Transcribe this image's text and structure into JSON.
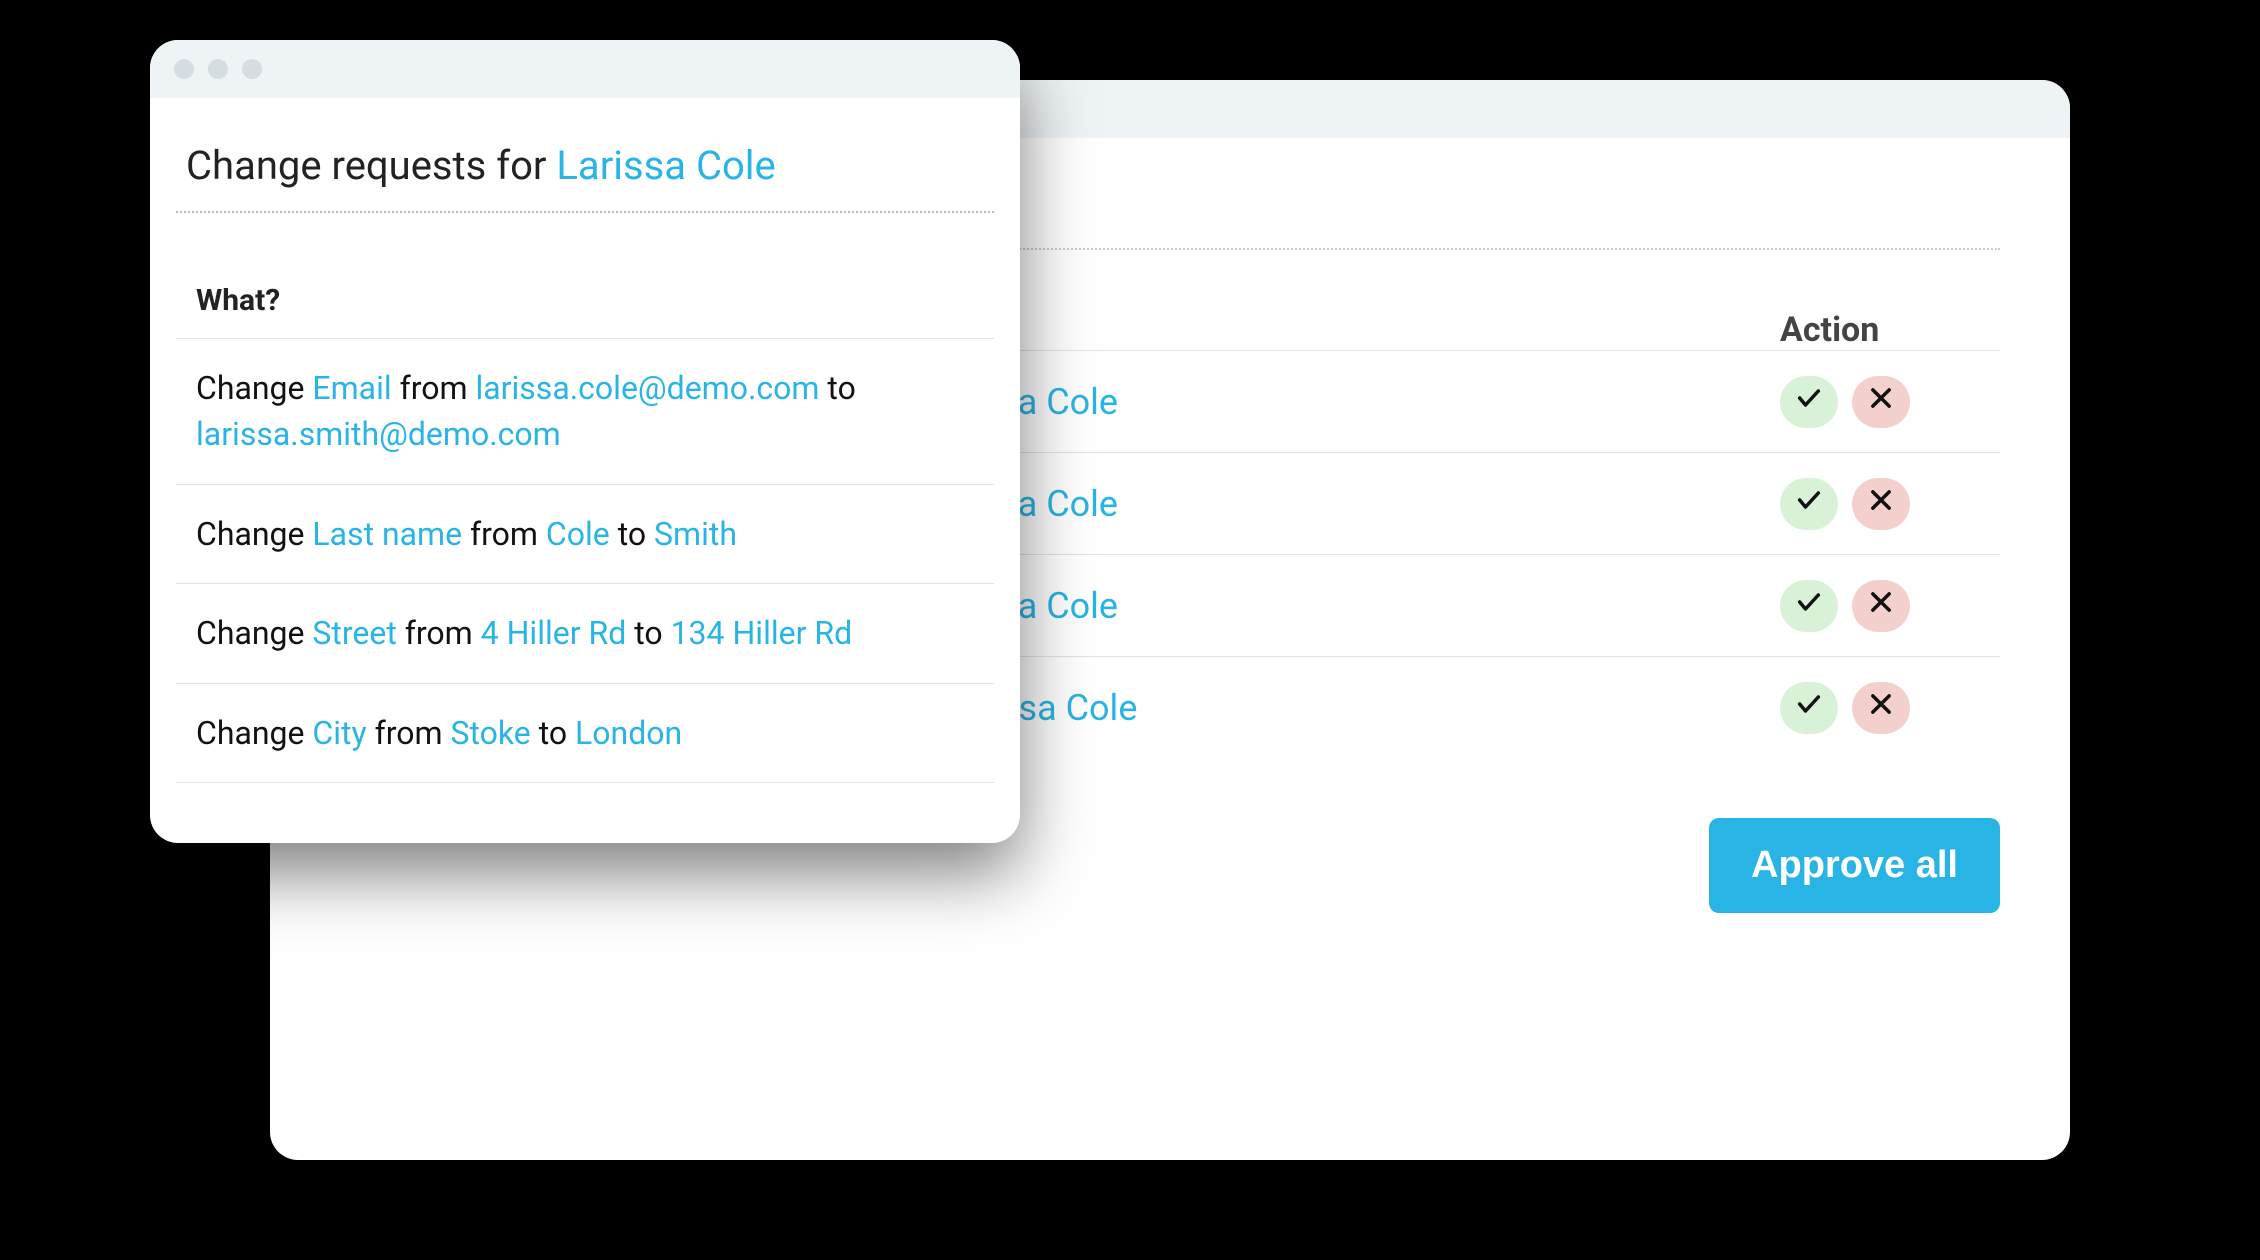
{
  "colors": {
    "accent": "#29b4e6",
    "approve_bg": "#d8f2d8",
    "reject_bg": "#f4d0cd"
  },
  "back": {
    "action_header": "Action",
    "approve_all_label": "Approve all",
    "rows": [
      {
        "who_visible": "arissa Cole"
      },
      {
        "who_visible": "arissa Cole"
      },
      {
        "who_visible": "arissa Cole"
      },
      {
        "who_visible": "Larissa Cole"
      }
    ]
  },
  "front": {
    "title_prefix": "Change requests for ",
    "title_person": "Larissa Cole",
    "what_label": "What?",
    "changes": [
      {
        "verb": "Change",
        "field": "Email",
        "from_word": "from",
        "from_value": "larissa.cole@demo.com",
        "to_word": "to",
        "to_value": "larissa.smith@demo.com"
      },
      {
        "verb": "Change",
        "field": "Last name",
        "from_word": "from",
        "from_value": "Cole",
        "to_word": "to",
        "to_value": "Smith"
      },
      {
        "verb": "Change",
        "field": "Street",
        "from_word": "from",
        "from_value": "4 Hiller Rd",
        "to_word": "to",
        "to_value": "134 Hiller Rd"
      },
      {
        "verb": "Change",
        "field": "City",
        "from_word": "from",
        "from_value": "Stoke",
        "to_word": "to",
        "to_value": "London"
      }
    ]
  }
}
